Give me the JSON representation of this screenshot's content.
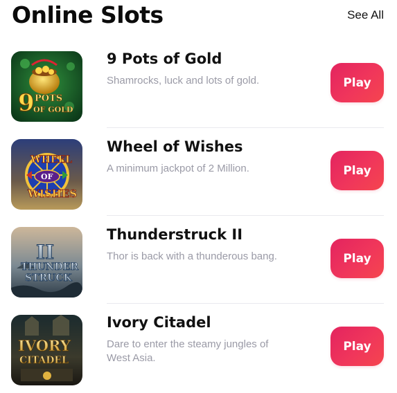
{
  "section": {
    "title": "Online Slots",
    "see_all_label": "See All"
  },
  "games": [
    {
      "name": "9 Pots of Gold",
      "description": "Shamrocks, luck and lots of gold.",
      "play_label": "Play",
      "thumb_text": [
        "9",
        "POTS",
        "OF GOLD"
      ]
    },
    {
      "name": "Wheel of Wishes",
      "description": "A minimum jackpot of 2 Million.",
      "play_label": "Play",
      "thumb_text": [
        "WHEEL",
        "OF",
        "WISHES"
      ]
    },
    {
      "name": "Thunderstruck II",
      "description": "Thor is back with a thunderous bang.",
      "play_label": "Play",
      "thumb_text": [
        "II",
        "THUNDER",
        "STRUCK"
      ]
    },
    {
      "name": "Ivory Citadel",
      "description": "Dare to enter the steamy jungles of West Asia.",
      "play_label": "Play",
      "thumb_text": [
        "IVORY",
        "CITADEL"
      ]
    }
  ],
  "colors": {
    "accent_start": "#e3245f",
    "accent_end": "#f5454e",
    "title": "#0b0b0b",
    "description": "#9a9aa6",
    "divider": "#e9e9ee"
  }
}
